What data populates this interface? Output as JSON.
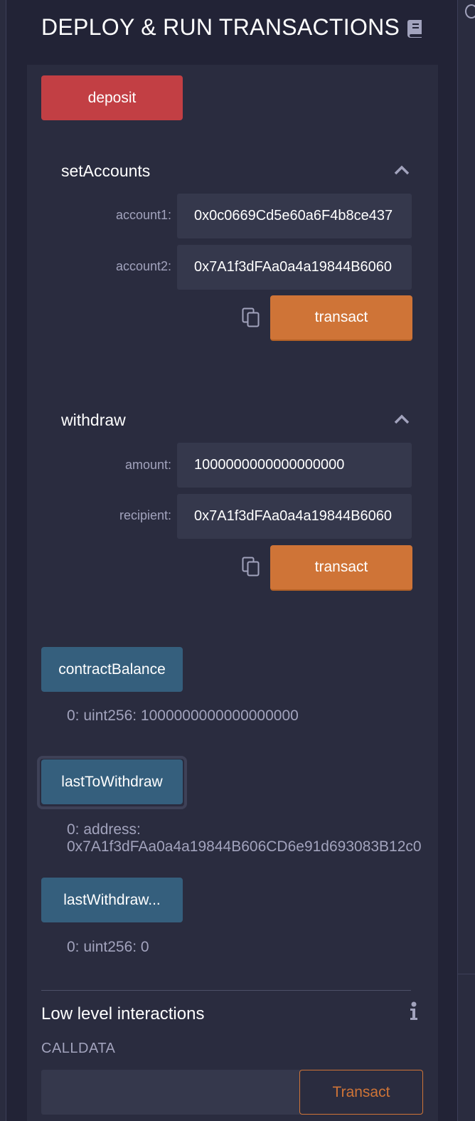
{
  "header": {
    "title": "DEPLOY & RUN TRANSACTIONS"
  },
  "buttons": {
    "deposit": "deposit",
    "transact": "transact",
    "contractBalance": "contractBalance",
    "lastToWithdraw": "lastToWithdraw",
    "lastWithdrawAmount": "lastWithdraw..."
  },
  "setAccounts": {
    "title": "setAccounts",
    "fields": [
      {
        "label": "account1:",
        "value": "0x0c0669Cd5e60a6F4b8ce437"
      },
      {
        "label": "account2:",
        "value": "0x7A1f3dFAa0a4a19844B6060"
      }
    ]
  },
  "withdraw": {
    "title": "withdraw",
    "fields": [
      {
        "label": "amount:",
        "value": "1000000000000000000"
      },
      {
        "label": "recipient:",
        "value": "0x7A1f3dFAa0a4a19844B6060"
      }
    ]
  },
  "results": {
    "contractBalance": "0: uint256: 1000000000000000000",
    "lastToWithdraw": "0:  address: 0x7A1f3dFAa0a4a19844B606CD6e91d693083B12c0",
    "lastWithdrawAmount": "0: uint256: 0"
  },
  "lowLevel": {
    "title": "Low level interactions",
    "calldata_label": "CALLDATA",
    "transact_label": "Transact"
  },
  "colors": {
    "background": "#222336",
    "panel": "#2a2c3f",
    "deposit": "#c23f44",
    "transact": "#cf7437",
    "call": "#355f7d"
  }
}
